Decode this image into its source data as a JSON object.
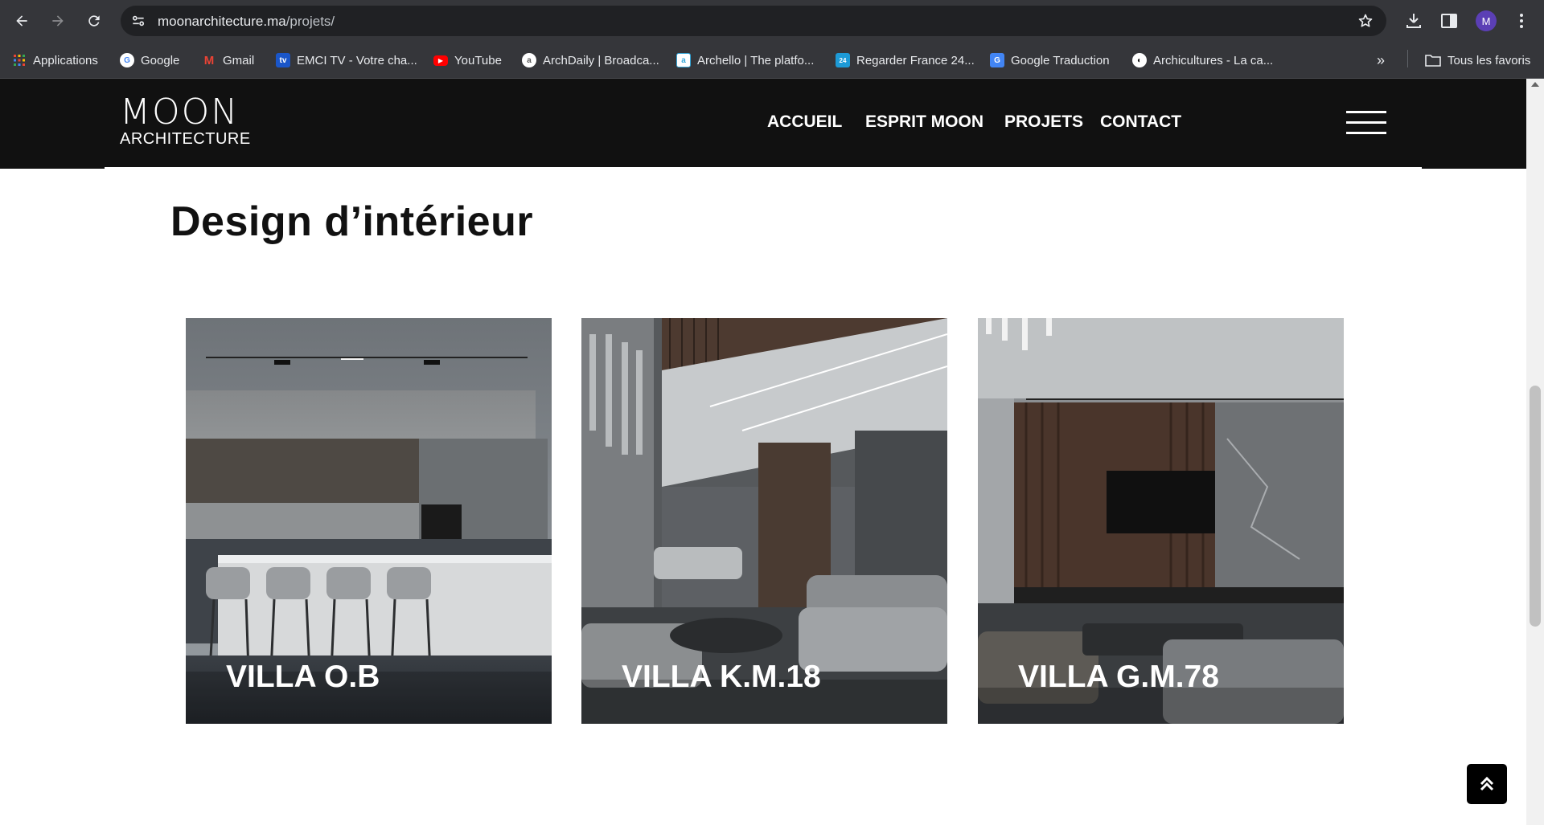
{
  "browser": {
    "url_host": "moonarchitecture.ma",
    "url_path": "/projets/",
    "profile_initial": "M",
    "bookmarks": [
      {
        "label": "Applications",
        "icon": "apps-grid-icon",
        "color": "#e94235"
      },
      {
        "label": "Google",
        "icon": "google-icon",
        "color": "#4285f4"
      },
      {
        "label": "Gmail",
        "icon": "gmail-icon",
        "color": "#ea4335"
      },
      {
        "label": "EMCI TV - Votre cha...",
        "icon": "emci-tv-icon",
        "color": "#1a56c9"
      },
      {
        "label": "YouTube",
        "icon": "youtube-icon",
        "color": "#ff0000"
      },
      {
        "label": "ArchDaily | Broadca...",
        "icon": "archdaily-icon",
        "color": "#9aa0a6"
      },
      {
        "label": "Archello | The platfo...",
        "icon": "archello-icon",
        "color": "#35a7d9"
      },
      {
        "label": "Regarder France 24...",
        "icon": "france24-icon",
        "color": "#1d9ad6"
      },
      {
        "label": "Google Traduction",
        "icon": "google-translate-icon",
        "color": "#4285f4"
      },
      {
        "label": "Archicultures - La ca...",
        "icon": "archicultures-icon",
        "color": "#2b2b2b"
      }
    ],
    "all_bookmarks_label": "Tous les favoris"
  },
  "site": {
    "logo_top": "MOON",
    "logo_bottom": "ARCHITECTURE",
    "menu": [
      "ACCUEIL",
      "ESPRIT MOON",
      "PROJETS",
      "CONTACT"
    ]
  },
  "section": {
    "title": "Design d’intérieur"
  },
  "projects": [
    {
      "title": "VILLA O.B"
    },
    {
      "title": "VILLA K.M.18"
    },
    {
      "title": "VILLA G.M.78"
    }
  ],
  "colors": {
    "header_bg": "#111111",
    "chrome_bg": "#35363a",
    "omnibox_bg": "#202124"
  }
}
